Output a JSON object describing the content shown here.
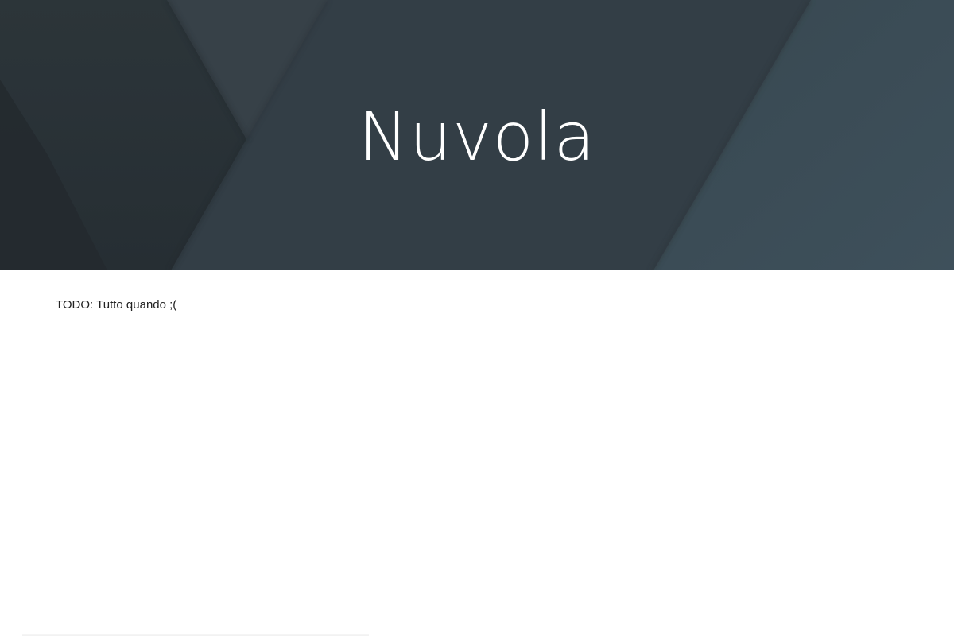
{
  "hero": {
    "title": "Nuvola"
  },
  "main": {
    "text": "TODO: Tutto quando ;("
  },
  "colors": {
    "hero_base": "#36424a",
    "hero_dark": "#2b3439",
    "hero_mid": "#394750",
    "hero_light": "#3e4f59",
    "title": "#ffffff",
    "body_text": "#222222",
    "background": "#ffffff"
  }
}
